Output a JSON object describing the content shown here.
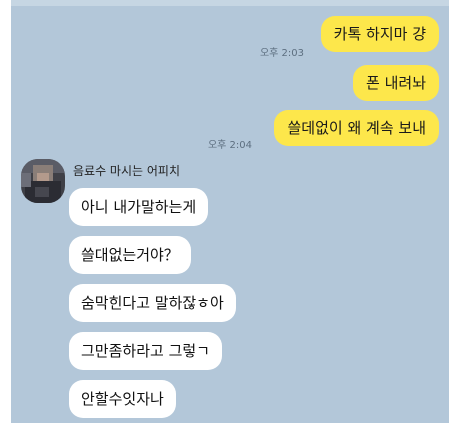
{
  "outgoing": [
    {
      "text": "카톡 하지마 걍",
      "time": "오후 2:03"
    },
    {
      "text": "폰 내려놔",
      "time": ""
    },
    {
      "text": "쓸데없이 왜 계속 보내",
      "time": "오후 2:04"
    }
  ],
  "incoming": {
    "sender": "음료수 마시는 어피치",
    "messages": [
      "아니 내가말하는게",
      "쓸대없는거야？",
      "숨막힌다고 말하잖ㅎ아",
      "그만좀하라고 그렇ㄱ",
      "안할수잇자나"
    ]
  },
  "colors": {
    "background": "#b3c7d9",
    "my_bubble": "#fde74b",
    "their_bubble": "#ffffff"
  }
}
